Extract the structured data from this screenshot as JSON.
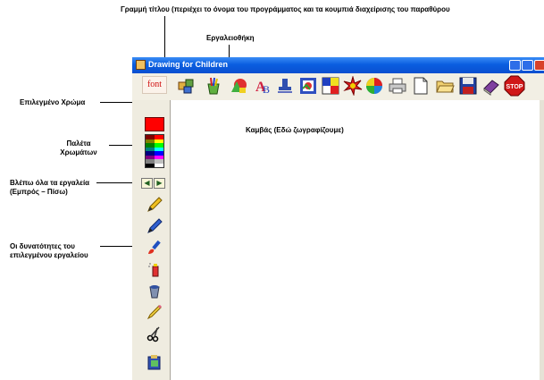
{
  "annotations": {
    "title_bar": "Γραμμή τίτλου (περιέχει το όνομα του προγράμματος και τα κουμπιά διαχείρισης του παραθύρου",
    "toolbox": "Εργαλειοθήκη",
    "selected_color": "Επιλεγμένο Χρώμα",
    "palette_line1": "Παλέτα",
    "palette_line2": "Χρωμάτων",
    "see_tools_line1": "Βλέπω όλα τα εργαλεία",
    "see_tools_line2": "(Εμπρός – Πίσω)",
    "tool_options_line1": "Οι δυνατότητες του",
    "tool_options_line2": "επιλεγμένου εργαλείου",
    "canvas": "Καμβάς (Εδώ ζωγραφίζουμε)"
  },
  "window": {
    "title": "Drawing for Children",
    "font_button_label": "font"
  },
  "colors": {
    "selected": "#ff0000",
    "palette": [
      "#800000",
      "#ff0000",
      "#808000",
      "#ffff00",
      "#008000",
      "#00ff00",
      "#008080",
      "#00ffff",
      "#000080",
      "#0000ff",
      "#800080",
      "#ff00ff",
      "#808080",
      "#c0c0c0",
      "#000000",
      "#ffffff"
    ]
  },
  "toolbar_icons": [
    "puzzle-icon",
    "paint-cup-icon",
    "color-shapes-icon",
    "letters-icon",
    "stamp-icon",
    "frame-icon",
    "flag-icon",
    "burst-icon",
    "swirl-icon",
    "printer-icon",
    "new-page-icon",
    "open-folder-icon",
    "save-disk-icon",
    "book-icon",
    "stop-icon"
  ],
  "stop_label": "STOP",
  "side_tools": [
    "pencil-icon",
    "pen-icon",
    "paintbrush-icon",
    "spray-can-icon",
    "paint-bucket-icon",
    "crayon-icon",
    "scissors-icon",
    "clipboard-icon"
  ]
}
